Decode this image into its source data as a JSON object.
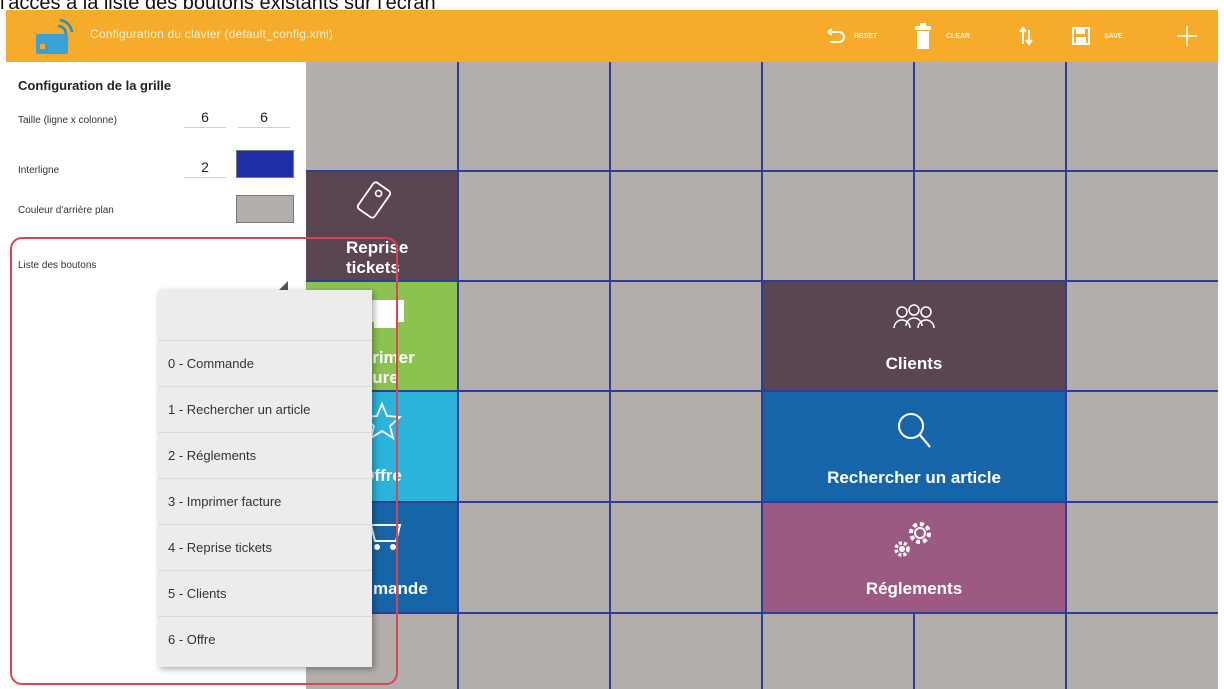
{
  "caption": "l'accès à la liste des boutons existants sur l'écran",
  "app": {
    "title": "Configuration du clavier (default_config.xml)"
  },
  "toolbar": {
    "reset_label": "RESET",
    "clear_label": "CLEAR",
    "save_label": "SAVE"
  },
  "panel": {
    "title": "Configuration de la grille",
    "size_label": "Taille (ligne x colonne)",
    "rows": "6",
    "cols": "6",
    "spacing_label": "Interligne",
    "spacing": "2",
    "spacing_color": "#1f2fa8",
    "background_label": "Couleur d'arrière plan",
    "background_color": "#b3adab",
    "buttons_list_label": "Liste des boutons"
  },
  "dropdown": {
    "items": [
      "0 - Commande",
      "1 - Rechercher un article",
      "2 - Réglements",
      "3 - Imprimer facture",
      "4 - Reprise tickets",
      "5 - Clients",
      "6 - Offre"
    ]
  },
  "tiles": {
    "reprise": {
      "label_1": "Reprise",
      "label_2": "tickets",
      "color": "#5a4552",
      "icon": "ticket-icon"
    },
    "imprimer": {
      "label_1": "Imprimer",
      "label_2": "facture",
      "color": "#8cc34f",
      "icon": "printer-icon"
    },
    "offre": {
      "label": "Offre",
      "color": "#2bb3d9",
      "icon": "star-icon"
    },
    "commande": {
      "label": "Commande",
      "color": "#1565a8",
      "icon": "cart-icon"
    },
    "clients": {
      "label": "Clients",
      "color": "#5a4552",
      "icon": "people-icon"
    },
    "rechercher": {
      "label": "Rechercher un article",
      "color": "#1565a8",
      "icon": "search-icon"
    },
    "reglements": {
      "label": "Réglements",
      "color": "#9c5a82",
      "icon": "gears-icon"
    }
  },
  "colors": {
    "appbar": "#f6ab2a",
    "grid_lines": "#2f3c9a",
    "highlight": "#d94459"
  }
}
